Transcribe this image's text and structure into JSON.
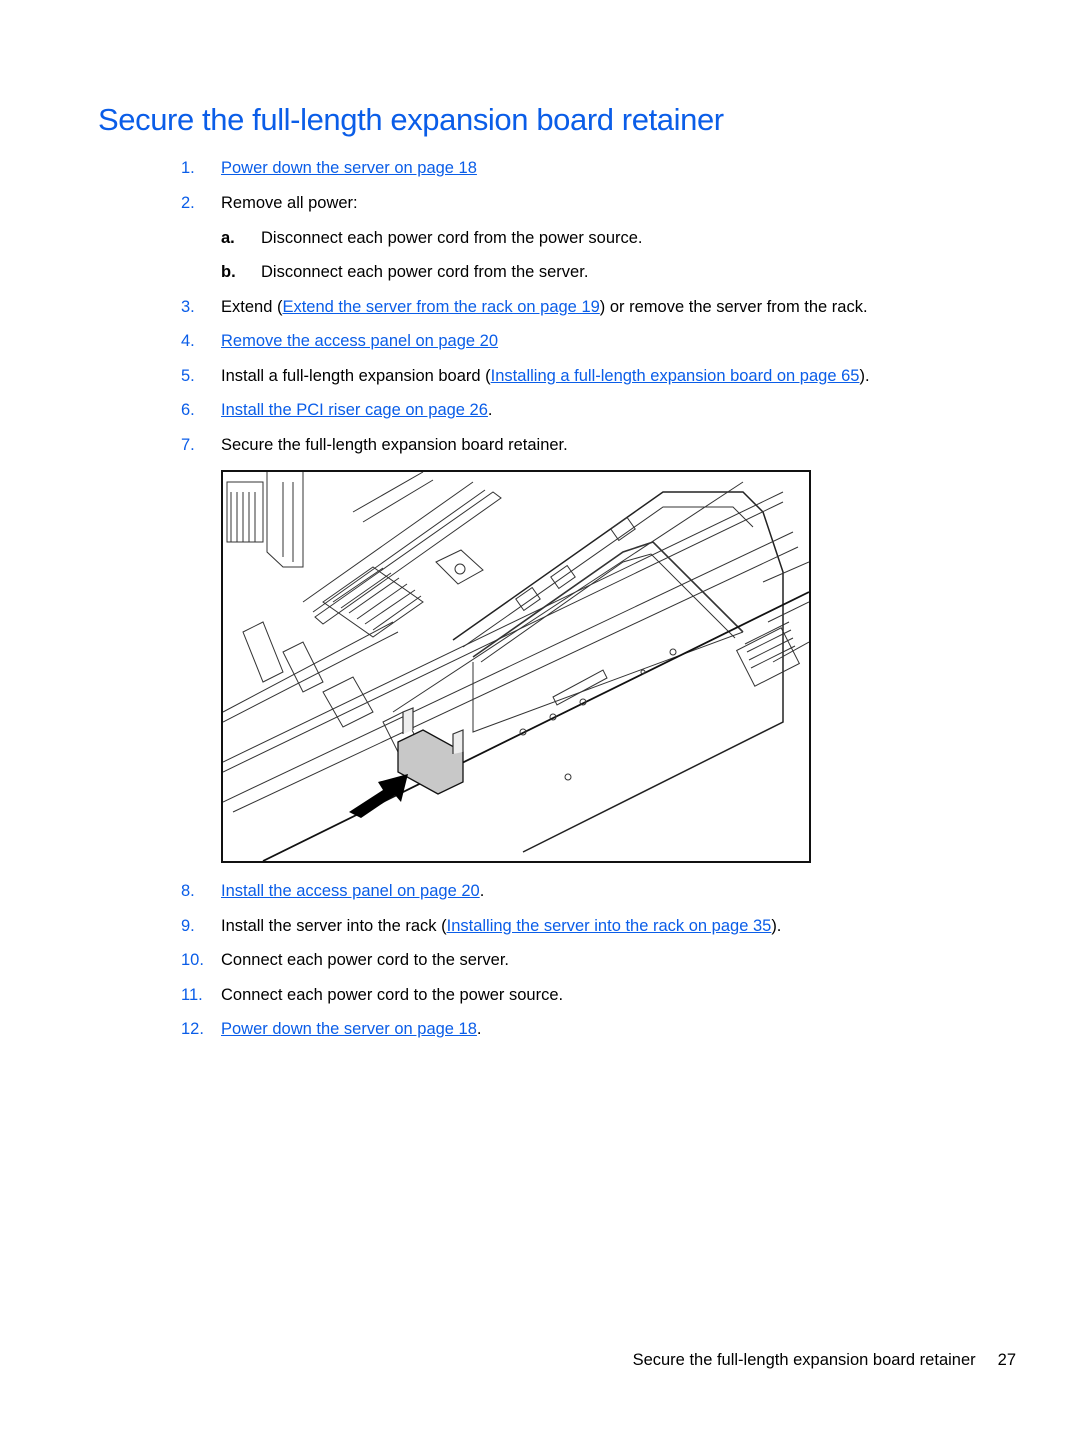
{
  "page": {
    "title": "Secure the full-length expansion board retainer",
    "accent_color": "#0a5de8",
    "steps": [
      {
        "num": "1.",
        "pre": "",
        "link": "Power down the server on page 18",
        "post": ""
      },
      {
        "num": "2.",
        "pre": "Remove all power:",
        "link": "",
        "post": ""
      },
      {
        "num": "a.",
        "pre": "Disconnect each power cord from the power source.",
        "link": "",
        "post": ""
      },
      {
        "num": "b.",
        "pre": "Disconnect each power cord from the server.",
        "link": "",
        "post": ""
      },
      {
        "num": "3.",
        "pre": "Extend (",
        "link": "Extend the server from the rack on page 19",
        "post": ") or remove the server from the rack."
      },
      {
        "num": "4.",
        "pre": "",
        "link": "Remove the access panel on page 20",
        "post": ""
      },
      {
        "num": "5.",
        "pre": "Install a full-length expansion board (",
        "link": "Installing a full-length expansion board on page 65",
        "post": ")."
      },
      {
        "num": "6.",
        "pre": "",
        "link": "Install the PCI riser cage on page 26",
        "post": "."
      },
      {
        "num": "7.",
        "pre": "Secure the full-length expansion board retainer.",
        "link": "",
        "post": ""
      },
      {
        "num": "8.",
        "pre": "",
        "link": "Install the access panel on page 20",
        "post": "."
      },
      {
        "num": "9.",
        "pre": "Install the server into the rack (",
        "link": "Installing the server into the rack on page 35",
        "post": ")."
      },
      {
        "num": "10.",
        "pre": "Connect each power cord to the server.",
        "link": "",
        "post": ""
      },
      {
        "num": "11.",
        "pre": "Connect each power cord to the power source.",
        "link": "",
        "post": ""
      },
      {
        "num": "12.",
        "pre": "",
        "link": "Power down the server on page 18",
        "post": "."
      }
    ],
    "figure": {
      "description": "Line illustration of server chassis with PCI riser cage; black arrow indicates securing the full-length expansion board retainer"
    },
    "footer": {
      "section": "Secure the full-length expansion board retainer",
      "page_number": "27"
    }
  }
}
